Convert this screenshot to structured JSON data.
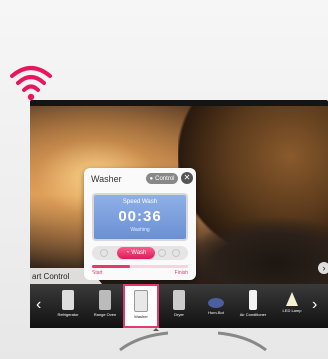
{
  "colors": {
    "accent": "#e33a6b",
    "wifi": "#e8175d"
  },
  "washer_panel": {
    "title": "Washer",
    "control_label": "Control",
    "mode": "Speed Wash",
    "time": "00:36",
    "status": "Washing",
    "cycle_label": "Wash",
    "start_label": "Start",
    "finish_label": "Finish",
    "progress": 0.4
  },
  "smart_control": {
    "title": "art Control",
    "items": [
      {
        "label": "Refrigerator",
        "icon": "refrigerator-icon"
      },
      {
        "label": "Range Oven",
        "icon": "range-oven-icon"
      },
      {
        "label": "Washer",
        "icon": "washer-icon",
        "selected": true
      },
      {
        "label": "Dryer",
        "icon": "dryer-icon"
      },
      {
        "label": "Hom-Bot",
        "icon": "robot-vacuum-icon"
      },
      {
        "label": "Air Conditioner",
        "icon": "air-conditioner-icon"
      },
      {
        "label": "LED Lamp",
        "icon": "led-lamp-icon"
      }
    ]
  }
}
